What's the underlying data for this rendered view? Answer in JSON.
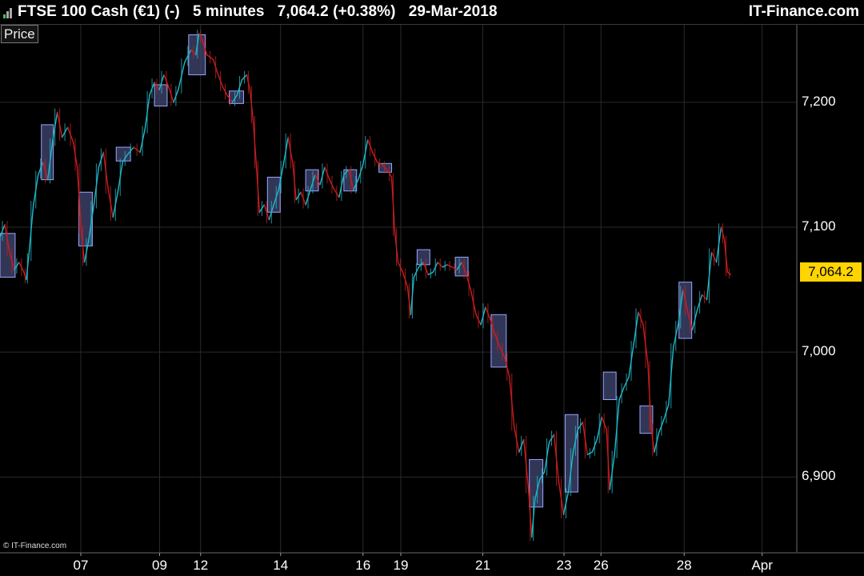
{
  "header": {
    "title": "FTSE 100 Cash (€1) (-)   5 minutes   7,064.2 (+0.38%)   29-Mar-2018",
    "brand": "IT-Finance.com",
    "signal_icon": "signal-bars-icon",
    "colors": {
      "bar1": "#3cc83c",
      "bar2": "#a8a8a8",
      "bar3": "#a8a8a8"
    }
  },
  "price_tab": "Price",
  "copyright": "© IT-Finance.com",
  "last_price": {
    "label": "7,064.2",
    "value": 7064.2,
    "color": "#ffd400"
  },
  "chart_data": {
    "type": "line",
    "colors": {
      "up": "#22b8c8",
      "down": "#c81e1e",
      "box_fill": "#3a3f66",
      "box_edge": "#9aa6ff",
      "grid": "#2a2a2a"
    },
    "y_axis": {
      "range": [
        6840,
        7262
      ],
      "ticks": [
        6900,
        7000,
        7100,
        7200
      ],
      "tick_labels": [
        "6,900",
        "7,000",
        "7,100",
        "7,200"
      ]
    },
    "x_axis": {
      "range": [
        0,
        100
      ],
      "ticks": [
        {
          "label": "07",
          "pos": 10.15
        },
        {
          "label": "09",
          "pos": 20.05
        },
        {
          "label": "12",
          "pos": 25.2
        },
        {
          "label": "14",
          "pos": 35.25
        },
        {
          "label": "16",
          "pos": 45.6
        },
        {
          "label": "19",
          "pos": 50.35
        },
        {
          "label": "21",
          "pos": 60.65
        },
        {
          "label": "23",
          "pos": 70.85
        },
        {
          "label": "26",
          "pos": 75.5
        },
        {
          "label": "28",
          "pos": 85.95
        },
        {
          "label": "Apr",
          "pos": 95.75
        }
      ]
    },
    "price_path": [
      [
        0.0,
        7092
      ],
      [
        0.6,
        7102
      ],
      [
        1.2,
        7080
      ],
      [
        1.8,
        7066
      ],
      [
        2.4,
        7072
      ],
      [
        3.0,
        7064
      ],
      [
        3.3,
        7058
      ],
      [
        3.6,
        7076
      ],
      [
        4.2,
        7118
      ],
      [
        4.8,
        7142
      ],
      [
        5.4,
        7152
      ],
      [
        6.0,
        7138
      ],
      [
        6.6,
        7168
      ],
      [
        7.2,
        7192
      ],
      [
        7.8,
        7172
      ],
      [
        8.5,
        7180
      ],
      [
        9.2,
        7168
      ],
      [
        9.7,
        7148
      ],
      [
        10.2,
        7098
      ],
      [
        10.6,
        7072
      ],
      [
        11.1,
        7088
      ],
      [
        11.8,
        7118
      ],
      [
        12.4,
        7148
      ],
      [
        13.0,
        7160
      ],
      [
        13.6,
        7130
      ],
      [
        14.2,
        7108
      ],
      [
        14.8,
        7128
      ],
      [
        15.4,
        7152
      ],
      [
        16.0,
        7158
      ],
      [
        16.8,
        7164
      ],
      [
        17.6,
        7160
      ],
      [
        18.2,
        7178
      ],
      [
        18.8,
        7206
      ],
      [
        19.4,
        7216
      ],
      [
        20.0,
        7210
      ],
      [
        20.6,
        7222
      ],
      [
        21.2,
        7212
      ],
      [
        21.8,
        7200
      ],
      [
        22.4,
        7210
      ],
      [
        23.2,
        7232
      ],
      [
        24.0,
        7242
      ],
      [
        24.6,
        7238
      ],
      [
        25.0,
        7255
      ],
      [
        25.4,
        7250
      ],
      [
        26.0,
        7238
      ],
      [
        26.8,
        7234
      ],
      [
        27.4,
        7222
      ],
      [
        28.0,
        7212
      ],
      [
        28.6,
        7205
      ],
      [
        29.2,
        7200
      ],
      [
        29.8,
        7206
      ],
      [
        30.4,
        7218
      ],
      [
        31.0,
        7222
      ],
      [
        31.4,
        7210
      ],
      [
        31.8,
        7186
      ],
      [
        32.2,
        7150
      ],
      [
        32.6,
        7112
      ],
      [
        33.2,
        7118
      ],
      [
        33.8,
        7106
      ],
      [
        34.4,
        7118
      ],
      [
        35.0,
        7130
      ],
      [
        35.6,
        7150
      ],
      [
        36.2,
        7172
      ],
      [
        36.8,
        7150
      ],
      [
        37.2,
        7122
      ],
      [
        37.8,
        7128
      ],
      [
        38.4,
        7118
      ],
      [
        39.0,
        7130
      ],
      [
        39.6,
        7142
      ],
      [
        40.2,
        7134
      ],
      [
        40.8,
        7148
      ],
      [
        41.4,
        7138
      ],
      [
        42.0,
        7130
      ],
      [
        42.6,
        7124
      ],
      [
        43.2,
        7142
      ],
      [
        43.8,
        7146
      ],
      [
        44.4,
        7130
      ],
      [
        45.0,
        7138
      ],
      [
        45.6,
        7150
      ],
      [
        46.2,
        7170
      ],
      [
        46.8,
        7160
      ],
      [
        47.4,
        7152
      ],
      [
        48.0,
        7150
      ],
      [
        48.6,
        7146
      ],
      [
        49.2,
        7140
      ],
      [
        49.6,
        7096
      ],
      [
        50.0,
        7072
      ],
      [
        50.6,
        7064
      ],
      [
        51.2,
        7052
      ],
      [
        51.6,
        7030
      ],
      [
        52.0,
        7060
      ],
      [
        52.6,
        7068
      ],
      [
        53.2,
        7072
      ],
      [
        53.8,
        7062
      ],
      [
        54.4,
        7064
      ],
      [
        55.0,
        7072
      ],
      [
        55.6,
        7068
      ],
      [
        56.2,
        7070
      ],
      [
        56.8,
        7068
      ],
      [
        57.4,
        7066
      ],
      [
        58.0,
        7072
      ],
      [
        58.6,
        7062
      ],
      [
        59.2,
        7048
      ],
      [
        59.8,
        7030
      ],
      [
        60.4,
        7022
      ],
      [
        61.0,
        7036
      ],
      [
        61.6,
        7026
      ],
      [
        62.2,
        7014
      ],
      [
        62.8,
        7004
      ],
      [
        63.4,
        6996
      ],
      [
        64.0,
        6980
      ],
      [
        64.6,
        6940
      ],
      [
        65.2,
        6920
      ],
      [
        65.8,
        6930
      ],
      [
        66.4,
        6890
      ],
      [
        66.8,
        6852
      ],
      [
        67.2,
        6882
      ],
      [
        67.8,
        6898
      ],
      [
        68.4,
        6904
      ],
      [
        69.0,
        6928
      ],
      [
        69.6,
        6934
      ],
      [
        70.2,
        6896
      ],
      [
        70.8,
        6870
      ],
      [
        71.4,
        6888
      ],
      [
        72.0,
        6920
      ],
      [
        72.6,
        6938
      ],
      [
        73.2,
        6944
      ],
      [
        73.8,
        6918
      ],
      [
        74.4,
        6920
      ],
      [
        75.0,
        6930
      ],
      [
        75.6,
        6948
      ],
      [
        76.2,
        6938
      ],
      [
        76.6,
        6890
      ],
      [
        77.2,
        6918
      ],
      [
        77.8,
        6962
      ],
      [
        78.4,
        6972
      ],
      [
        79.0,
        6980
      ],
      [
        79.6,
        7006
      ],
      [
        80.2,
        7032
      ],
      [
        80.8,
        7022
      ],
      [
        81.4,
        6990
      ],
      [
        81.8,
        6940
      ],
      [
        82.2,
        6920
      ],
      [
        82.8,
        6936
      ],
      [
        83.4,
        6946
      ],
      [
        84.0,
        6958
      ],
      [
        84.6,
        7004
      ],
      [
        85.2,
        7022
      ],
      [
        85.8,
        7050
      ],
      [
        86.4,
        7032
      ],
      [
        87.0,
        7018
      ],
      [
        87.6,
        7034
      ],
      [
        88.2,
        7046
      ],
      [
        88.8,
        7042
      ],
      [
        89.4,
        7080
      ],
      [
        90.0,
        7072
      ],
      [
        90.6,
        7100
      ],
      [
        91.0,
        7090
      ],
      [
        91.4,
        7064
      ],
      [
        91.8,
        7062
      ]
    ],
    "boxes": [
      {
        "x0": 0.0,
        "x1": 1.9,
        "low": 7060,
        "high": 7095
      },
      {
        "x0": 5.2,
        "x1": 6.7,
        "low": 7138,
        "high": 7182
      },
      {
        "x0": 9.9,
        "x1": 11.6,
        "low": 7085,
        "high": 7128
      },
      {
        "x0": 14.6,
        "x1": 16.4,
        "low": 7153,
        "high": 7164
      },
      {
        "x0": 19.4,
        "x1": 21.0,
        "low": 7197,
        "high": 7214
      },
      {
        "x0": 23.7,
        "x1": 25.8,
        "low": 7222,
        "high": 7254
      },
      {
        "x0": 28.8,
        "x1": 30.6,
        "low": 7199,
        "high": 7209
      },
      {
        "x0": 33.6,
        "x1": 35.2,
        "low": 7112,
        "high": 7140
      },
      {
        "x0": 38.4,
        "x1": 40.0,
        "low": 7129,
        "high": 7146
      },
      {
        "x0": 43.2,
        "x1": 44.8,
        "low": 7129,
        "high": 7146
      },
      {
        "x0": 47.6,
        "x1": 49.2,
        "low": 7144,
        "high": 7151
      },
      {
        "x0": 52.4,
        "x1": 54.0,
        "low": 7070,
        "high": 7082
      },
      {
        "x0": 57.2,
        "x1": 58.8,
        "low": 7061,
        "high": 7076
      },
      {
        "x0": 61.7,
        "x1": 63.6,
        "low": 6988,
        "high": 7030
      },
      {
        "x0": 66.5,
        "x1": 68.2,
        "low": 6876,
        "high": 6914
      },
      {
        "x0": 71.0,
        "x1": 72.6,
        "low": 6888,
        "high": 6950
      },
      {
        "x0": 75.8,
        "x1": 77.4,
        "low": 6962,
        "high": 6984
      },
      {
        "x0": 80.4,
        "x1": 82.0,
        "low": 6935,
        "high": 6957
      },
      {
        "x0": 85.3,
        "x1": 86.9,
        "low": 7011,
        "high": 7056
      }
    ]
  }
}
